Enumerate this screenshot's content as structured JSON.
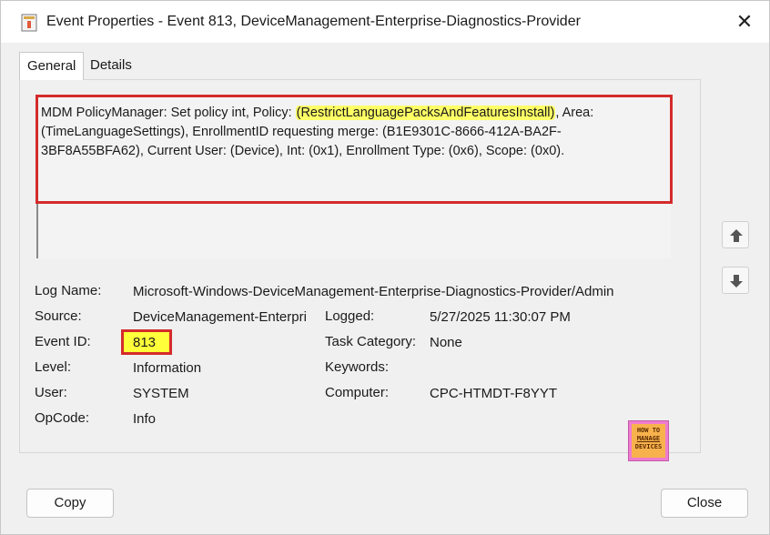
{
  "window": {
    "title": "Event Properties - Event 813, DeviceManagement-Enterprise-Diagnostics-Provider",
    "close_glyph": "✕"
  },
  "tabs": [
    {
      "label": "General",
      "active": true
    },
    {
      "label": "Details",
      "active": false
    }
  ],
  "description": {
    "part1": "MDM PolicyManager: Set policy int, Policy: ",
    "policy": "(RestrictLanguagePacksAndFeaturesInstall)",
    "part2": ", Area: (TimeLanguageSettings), EnrollmentID requesting merge: (B1E9301C-8666-412A-BA2F-3BF8A55BFA62), Current User: (Device), Int: (0x1), Enrollment Type: (0x6), Scope: (0x0)."
  },
  "fields": {
    "log_name_label": "Log Name:",
    "log_name": "Microsoft-Windows-DeviceManagement-Enterprise-Diagnostics-Provider/Admin",
    "source_label": "Source:",
    "source": "DeviceManagement-Enterpri",
    "logged_label": "Logged:",
    "logged": "5/27/2025 11:30:07 PM",
    "event_id_label": "Event ID:",
    "event_id": "813",
    "task_category_label": "Task Category:",
    "task_category": "None",
    "level_label": "Level:",
    "level": "Information",
    "keywords_label": "Keywords:",
    "keywords": "",
    "user_label": "User:",
    "user": "SYSTEM",
    "computer_label": "Computer:",
    "computer": "CPC-HTMDT-F8YYT",
    "opcode_label": "OpCode:",
    "opcode": "Info"
  },
  "logo": {
    "line1": "HOW TO",
    "line2": "MANAGE",
    "line3": "DEVICES"
  },
  "buttons": {
    "copy": "Copy",
    "close": "Close"
  },
  "icons": {
    "scroll_up": "arrow-up-icon",
    "scroll_down": "arrow-down-icon",
    "app": "event-viewer-icon"
  },
  "colors": {
    "highlight_red": "#d42b2b",
    "highlight_yellow": "#ffff66"
  }
}
